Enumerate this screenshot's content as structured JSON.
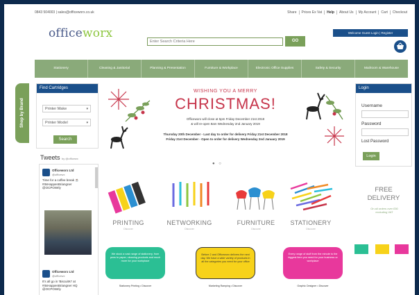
{
  "topbar": {
    "contact": "0843 504003  |  sales@officeworx.co.uk",
    "links": [
      "Share",
      "Prices Ex Vat",
      "Help",
      "About Us",
      "My Account",
      "Cart",
      "Checkout"
    ]
  },
  "header": {
    "logo_office": "office",
    "logo_worx": "worx",
    "search_placeholder": "Enter Search Criteria Here",
    "go_label": "GO",
    "welcome": "Welcome Guest  Login  |  Register",
    "basket_icon": "basket-icon"
  },
  "nav": [
    "Stationery",
    "Cleaning & Janitorial",
    "Planning & Presentation",
    "Furniture & Workplace",
    "Electronic Office Supplies",
    "Safety & Security",
    "Mailroom & Warehouse"
  ],
  "brand_tab": "Shop by Brand",
  "find_cartridges": {
    "title": "Find Cartridges",
    "make": "Printer Make",
    "model": "Printer Model",
    "search": "Search"
  },
  "tweets": {
    "title": "Tweets",
    "by": "by @officewx",
    "items": [
      {
        "name": "Officeworx Ltd",
        "handle": "@officewx",
        "text": "Time for a coffee break ☕ #ItsHappenBriangner @OCPOWrly"
      },
      {
        "name": "Officeworx Ltd",
        "handle": "@officewx",
        "text": "It's all go in 'BiscuitK!' at #ItsHappenBriangner HQ @OCPOWrly"
      }
    ]
  },
  "banner": {
    "top": "WISHING YOU A MERRY",
    "main": "CHRISTMAS!",
    "lines": [
      "Officeworx will close at 5pm Friday December 21st 2018",
      "& will re-open 8am Wednesday 2nd January 2019"
    ],
    "bold_lines": [
      "Thursday 20th December - Last day to order for delivery Friday 21st December 2018",
      "Friday 21st December - Open to order for delivery Wednesday 2nd January 2019"
    ],
    "dots": "● ○"
  },
  "categories": [
    {
      "label": "PRINTING",
      "sub": "Discover"
    },
    {
      "label": "NETWORKING",
      "sub": "Discover"
    },
    {
      "label": "FURNITURE",
      "sub": "Discover"
    },
    {
      "label": "STATIONERY",
      "sub": "Discover"
    }
  ],
  "free_delivery": {
    "line1": "FREE",
    "line2": "DELIVERY",
    "sub": "On all orders over £50 excluding VAT"
  },
  "login": {
    "title": "Login",
    "username": "Username",
    "password": "Password",
    "lost": "Lost Password",
    "button": "Login"
  },
  "bubbles": [
    {
      "text": "We stock a vast range of stationery, from pens to paper, cleaning products and much more for your workplace",
      "caption": "Stationery Printing • Discover",
      "color": "#2bbf94"
    },
    {
      "text": "Before 2 and Officeworx delivers the next day. We have a wide variety of products in all the categories you need for your office",
      "caption": "Marketing Ramping • Discover",
      "color": "#f7d21a"
    },
    {
      "text": "Every range of stuff from the minute to the biggest item you need for your business or workplace",
      "caption": "Graphic Designer • Discover",
      "color": "#e8389c"
    }
  ],
  "swatch_colors": [
    "#2bbf94",
    "#f7d21a",
    "#e8389c"
  ]
}
